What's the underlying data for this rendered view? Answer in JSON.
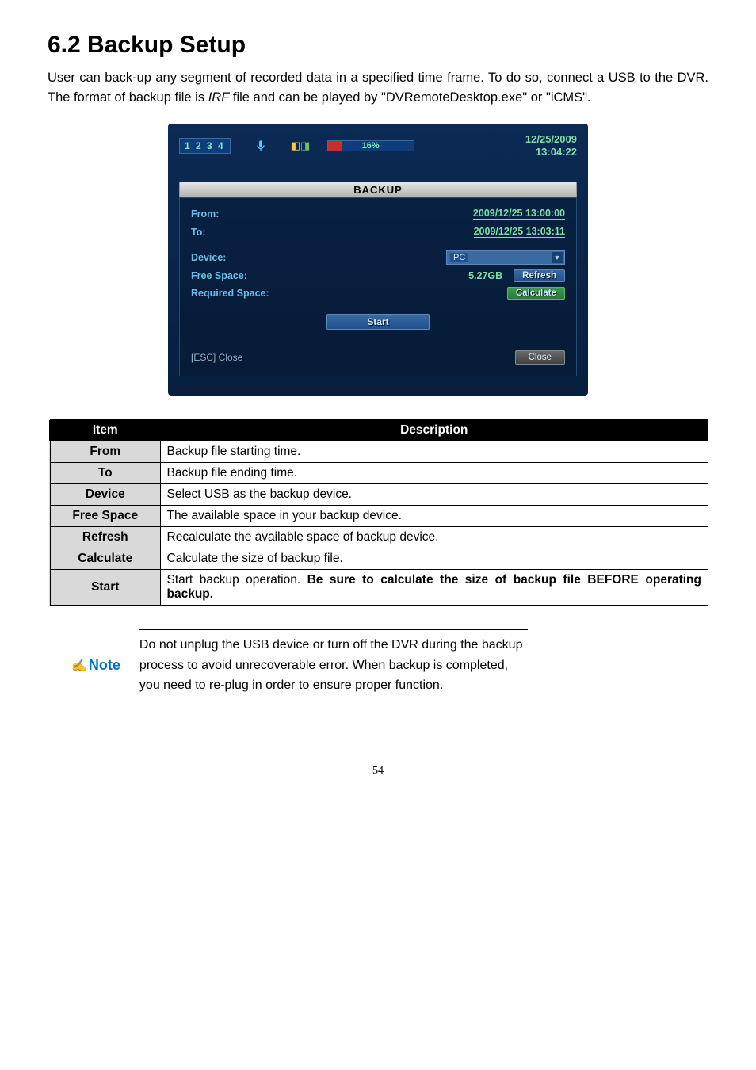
{
  "heading": "6.2 Backup Setup",
  "intro_parts": {
    "p1": "User can back-up any segment of recorded data in a specified time frame. To do so, connect a USB to the DVR. The format of backup file is ",
    "irf": "IRF",
    "p2": " file and can be played by \"DVRemoteDesktop.exe\" or \"iCMS\"."
  },
  "screenshot": {
    "channels": "1 2 3 4",
    "progress_text": "16%",
    "clock": {
      "date": "12/25/2009",
      "time": "13:04:22"
    },
    "panel_title": "BACKUP",
    "from": {
      "label": "From:",
      "value": "2009/12/25 13:00:00"
    },
    "to": {
      "label": "To:",
      "value": "2009/12/25 13:03:11"
    },
    "device": {
      "label": "Device:",
      "value": "PC"
    },
    "free_space": {
      "label": "Free Space:",
      "value": "5.27GB"
    },
    "required_space_label": "Required Space:",
    "refresh_btn": "Refresh",
    "calculate_btn": "Calculate",
    "start_btn": "Start",
    "esc_label": "[ESC] Close",
    "close_btn": "Close"
  },
  "table": {
    "hdr_item": "Item",
    "hdr_desc": "Description",
    "rows": [
      {
        "label": "From",
        "desc": "Backup file starting time."
      },
      {
        "label": "To",
        "desc": "Backup file ending time."
      },
      {
        "label": "Device",
        "desc": "Select USB as the backup device."
      },
      {
        "label": "Free Space",
        "desc": "The available space in your backup device."
      },
      {
        "label": "Refresh",
        "desc": "Recalculate the available space of backup device."
      },
      {
        "label": "Calculate",
        "desc": "Calculate the size of backup file."
      }
    ],
    "start_row": {
      "label": "Start",
      "desc_plain": "Start backup operation. ",
      "desc_bold": "Be sure to calculate the size of backup file BEFORE operating backup."
    }
  },
  "note": {
    "label": "Note",
    "text": "Do not unplug the USB device or turn off the DVR during the backup process to avoid unrecoverable error. When backup is completed, you need to re-plug in order to ensure proper function."
  },
  "page_number": "54"
}
